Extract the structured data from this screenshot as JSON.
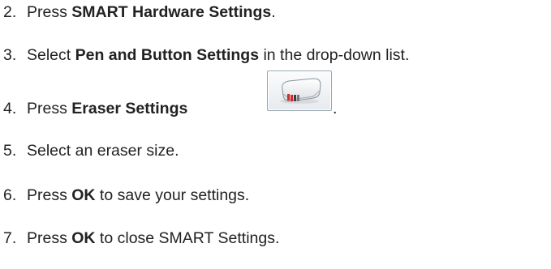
{
  "steps": [
    {
      "number": "2.",
      "pre": "Press ",
      "bold": "SMART Hardware Settings",
      "post": "."
    },
    {
      "number": "3.",
      "pre": "Select ",
      "bold": "Pen and Button Settings",
      "post": " in the drop-down list."
    },
    {
      "number": "4.",
      "pre": "Press ",
      "bold": "Eraser Settings",
      "post": ".",
      "icon": "eraser-icon"
    },
    {
      "number": "5.",
      "pre": "Select an eraser size.",
      "bold": "",
      "post": ""
    },
    {
      "number": "6.",
      "pre": "Press ",
      "bold": "OK",
      "post": " to save your settings."
    },
    {
      "number": "7.",
      "pre": "Press ",
      "bold": "OK",
      "post": " to close SMART Settings."
    }
  ]
}
